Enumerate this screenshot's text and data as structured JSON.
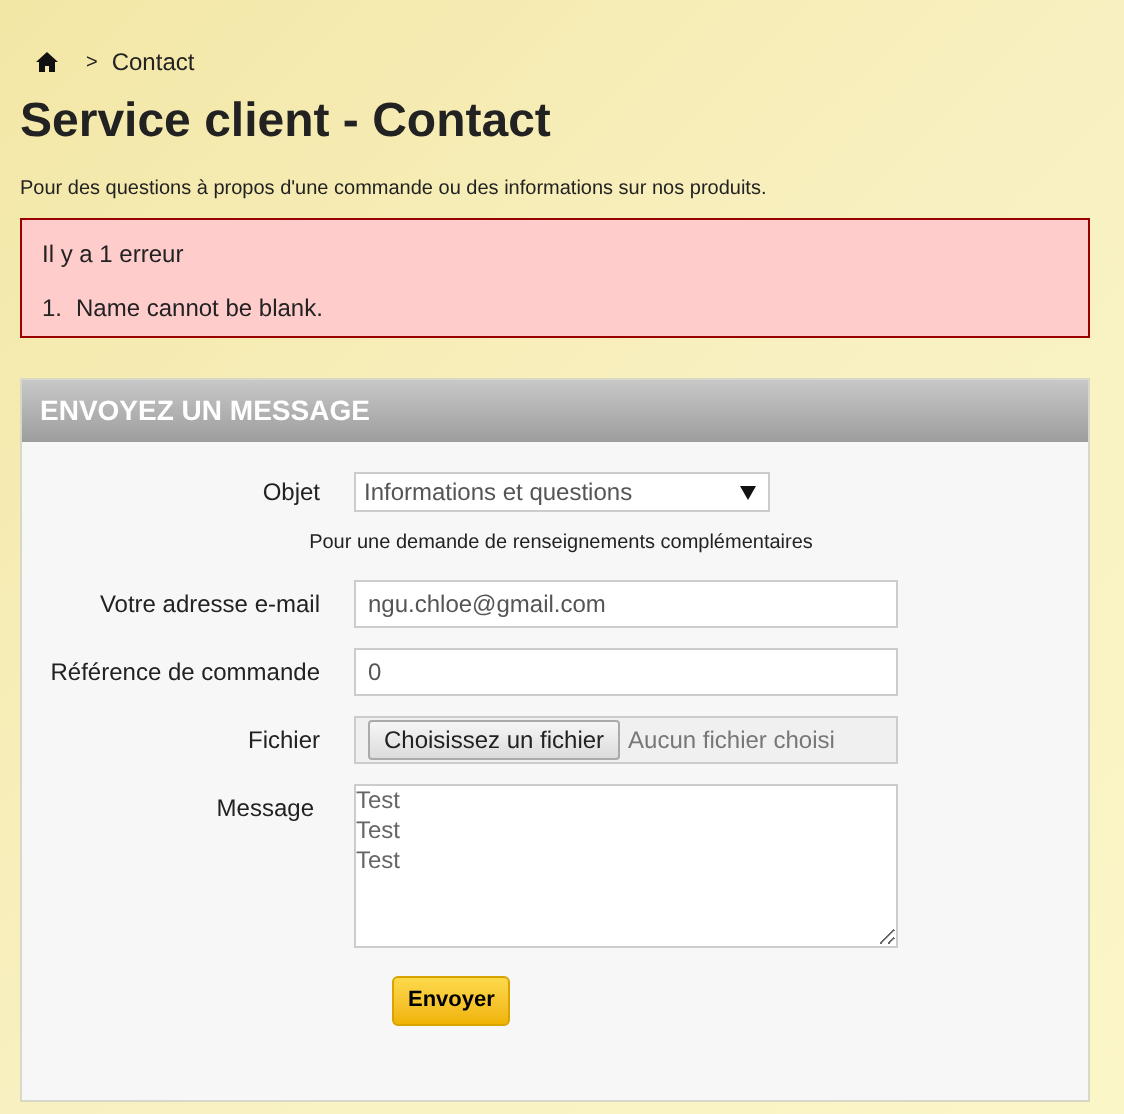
{
  "breadcrumb": [
    {
      "separator": ">",
      "label": "Contact"
    }
  ],
  "title": "Service client - Contact",
  "intro": "Pour des questions à propos d'une commande ou des informations sur nos produits.",
  "errors": {
    "heading": "Il y a 1 erreur",
    "items": [
      {
        "number": "1.",
        "text": "Name cannot be blank."
      }
    ]
  },
  "form": {
    "heading": "ENVOYEZ UN MESSAGE",
    "fields": [
      {
        "kind": "select",
        "label": "Objet",
        "value": "Informations et questions"
      },
      {
        "kind": "note",
        "text": "Pour une demande de renseignements complémentaires"
      },
      {
        "kind": "text",
        "label": "Votre adresse e-mail",
        "value": "ngu.chloe@gmail.com"
      },
      {
        "kind": "text",
        "label": "Référence de commande",
        "value": "0"
      },
      {
        "kind": "file",
        "label": "Fichier",
        "button": "Choisissez un fichier",
        "status": "Aucun fichier choisi"
      },
      {
        "kind": "textarea",
        "label": "Message",
        "value": "Test\nTest\nTest"
      }
    ],
    "submit": "Envoyer"
  }
}
